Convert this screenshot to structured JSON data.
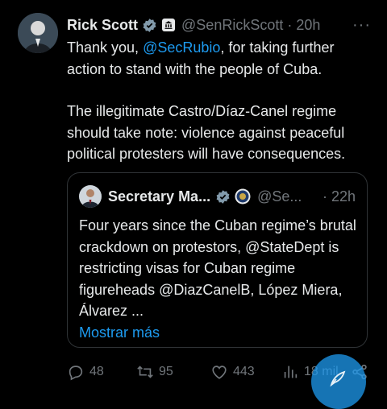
{
  "tweet": {
    "author_name": "Rick Scott",
    "handle": "@SenRickScott",
    "separator": "·",
    "time": "20h",
    "more_label": "···",
    "body_p1_pre": "Thank you, ",
    "body_p1_mention": "@SecRubio",
    "body_p1_post": ", for taking further action to stand with the people of Cuba.",
    "body_p2": "The illegitimate Castro/Díaz-Canel regime should take note: violence against peaceful political protesters will have consequences."
  },
  "quote": {
    "author_name": "Secretary Ma...",
    "handle": "@Se...",
    "time": "· 22h",
    "text": "Four years since the Cuban regime’s brutal crackdown on protestors, @StateDept is restricting visas for Cuban regime figureheads @DiazCanelB, López Miera, Álvarez ...",
    "show_more": "Mostrar más"
  },
  "actions": {
    "replies": "48",
    "retweets": "95",
    "likes": "443",
    "views": "18 mil"
  },
  "colors": {
    "background": "#000000",
    "text": "#e7e9ea",
    "secondary": "#71767b",
    "accent": "#1d9bf0",
    "border": "#2f3336"
  },
  "icons": [
    "verified-badge-icon",
    "government-badge-icon",
    "more-icon",
    "state-seal-icon",
    "reply-icon",
    "retweet-icon",
    "like-icon",
    "views-icon",
    "share-icon",
    "compose-icon"
  ]
}
